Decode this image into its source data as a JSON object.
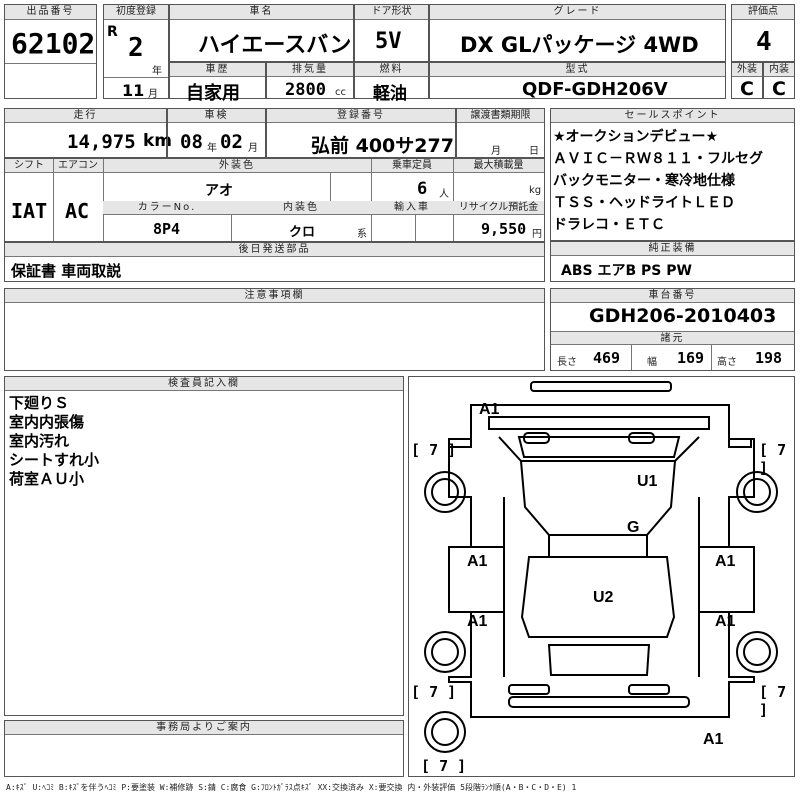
{
  "header": {
    "lot_label": "出品番号",
    "lot_number": "62102",
    "first_reg_label": "初度登録",
    "era": "R",
    "year": "2",
    "year_unit": "年",
    "month": "11",
    "month_unit": "月",
    "name_label": "車名",
    "name": "ハイエースバン",
    "door_label": "ドア形状",
    "door": "5V",
    "grade_label": "グレード",
    "grade": "DX GLパッケージ 4WD",
    "score_label": "評価点",
    "score": "4",
    "history_label": "車歴",
    "history": "自家用",
    "disp_label": "排気量",
    "disp": "2800",
    "disp_unit": "cc",
    "fuel_label": "燃料",
    "fuel": "軽油",
    "model_label": "型式",
    "model": "QDF-GDH206V",
    "ext_label": "外装",
    "ext": "C",
    "int_label": "内装",
    "int": "C"
  },
  "row2": {
    "mileage_label": "走行",
    "mileage": "14,975",
    "mileage_unit": "km",
    "inspection_label": "車検",
    "insp_year": "08",
    "insp_year_unit": "年",
    "insp_month": "02",
    "insp_month_unit": "月",
    "plate_label": "登録番号",
    "plate": "弘前 400サ277",
    "transfer_label": "譲渡書類期限",
    "transfer_month": "月",
    "transfer_day": "日",
    "shift_label": "シフト",
    "shift": "IAT",
    "ac_label": "エアコン",
    "ac": "AC",
    "ext_color_label": "外装色",
    "ext_color": "アオ",
    "capacity_label": "乗車定員",
    "capacity": "6",
    "capacity_unit": "人",
    "load_label": "最大積載量",
    "load_unit": "kg",
    "color_no_label": "カラーNo.",
    "color_no": "8P4",
    "int_color_label": "内装色",
    "int_color": "クロ",
    "int_color_unit": "系",
    "import_label": "輸入車",
    "recycle_label": "リサイクル預託金",
    "recycle": "9,550",
    "recycle_unit": "円",
    "parts_label": "後日発送部品",
    "parts": "保証書 車両取説"
  },
  "sales": {
    "label": "セールスポイント",
    "lines": [
      "★オークションデビュー★",
      "ＡＶＩＣ－ＲＷ８１１・フルセグ",
      "バックモニター・寒冷地仕様",
      "ＴＳＳ・ヘッドライトＬＥＤ",
      "ドラレコ・ＥＴＣ"
    ]
  },
  "equipment": {
    "label": "純正装備",
    "value": "ABS エアB PS PW"
  },
  "notes": {
    "label": "注意事項欄"
  },
  "chassis": {
    "label": "車台番号",
    "value": "GDH206-2010403",
    "dims_label": "諸元",
    "len_label": "長さ",
    "len": "469",
    "wid_label": "幅",
    "wid": "169",
    "hgt_label": "高さ",
    "hgt": "198"
  },
  "inspector": {
    "label": "検査員記入欄",
    "lines": [
      "下廻りＳ",
      "室内内張傷",
      "室内汚れ",
      "シートすれ小",
      "荷室ＡＵ小"
    ]
  },
  "office": {
    "label": "事務局よりご案内"
  },
  "diagram": {
    "marks": {
      "a1_top": "A1",
      "u1": "U1",
      "g": "G",
      "a1_left1": "A1",
      "a1_right1": "A1",
      "u2": "U2",
      "a1_left2": "A1",
      "a1_right2": "A1",
      "a1_bottom": "A1"
    },
    "tires": {
      "fl": "7",
      "fr": "7",
      "rl": "7",
      "rr": "7",
      "spare": "7"
    }
  },
  "legend": "A:ｷｽﾞ U:ﾍｺﾐ B:ｷｽﾞを伴うﾍｺﾐ P:要塗装 W:補修跡 S:錆 C:腐食 G:ﾌﾛﾝﾄｶﾞﾗｽ点ｷｽﾞ XX:交換済み X:要交換 内・外装評価 5段階ﾗﾝｸ順(A・B・C・D・E) 1"
}
